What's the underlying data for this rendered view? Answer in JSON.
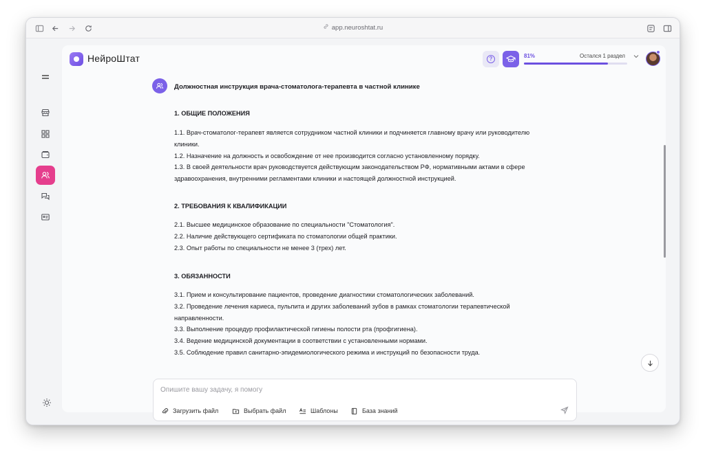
{
  "browser": {
    "url": "app.neuroshtat.ru"
  },
  "app": {
    "brand": "НейроШтат"
  },
  "progress": {
    "percent_label": "81%",
    "percent": 81,
    "note": "Остался 1 раздел"
  },
  "document": {
    "title": "Должностная инструкция врача-стоматолога-терапевта в частной клинике",
    "sections": [
      {
        "heading": "1. ОБЩИЕ ПОЛОЖЕНИЯ",
        "lines": [
          "1.1. Врач-стоматолог-терапевт является сотрудником частной клиники и подчиняется главному врачу или руководителю",
          "клиники.",
          "1.2. Назначение на должность и освобождение от нее производится согласно установленному порядку.",
          "1.3. В своей деятельности врач руководствуется действующим законодательством РФ, нормативными актами в сфере",
          "здравоохранения, внутренними регламентами клиники и настоящей должностной инструкцией."
        ]
      },
      {
        "heading": "2. ТРЕБОВАНИЯ К КВАЛИФИКАЦИИ",
        "lines": [
          "2.1. Высшее медицинское образование по специальности \"Стоматология\".",
          "2.2. Наличие действующего сертификата по стоматологии общей практики.",
          "2.3. Опыт работы по специальности не менее 3 (трех) лет."
        ]
      },
      {
        "heading": "3. ОБЯЗАННОСТИ",
        "lines": [
          "3.1. Прием и консультирование пациентов, проведение диагностики стоматологических заболеваний.",
          "3.2. Проведение лечения кариеса, пульпита и других заболеваний зубов в рамках стоматологии терапевтической",
          "направленности.",
          "3.3. Выполнение процедур профилактической гигиены полости рта (профгигиена).",
          "3.4. Ведение медицинской документации в соответствии с установленными нормами.",
          "3.5. Соблюдение правил санитарно-эпидемиологического режима и инструкций по безопасности труда."
        ]
      }
    ]
  },
  "composer": {
    "placeholder": "Опишите вашу задачу, я помогу",
    "upload_label": "Загрузить файл",
    "select_label": "Выбрать файл",
    "templates_label": "Шаблоны",
    "knowledge_label": "База знаний"
  },
  "colors": {
    "accent": "#7b61e8",
    "active_nav": "#e53e8d"
  },
  "icons": {
    "rail": [
      "menu-icon",
      "store-icon",
      "grid-icon",
      "archive-icon",
      "users-icon",
      "chat-icon",
      "id-card-icon",
      "sun-icon"
    ],
    "top": [
      "help-icon",
      "graduation-cap-icon",
      "chevron-down-icon"
    ],
    "composer": [
      "paperclip-icon",
      "folder-icon",
      "text-format-icon",
      "book-icon",
      "send-icon"
    ]
  }
}
